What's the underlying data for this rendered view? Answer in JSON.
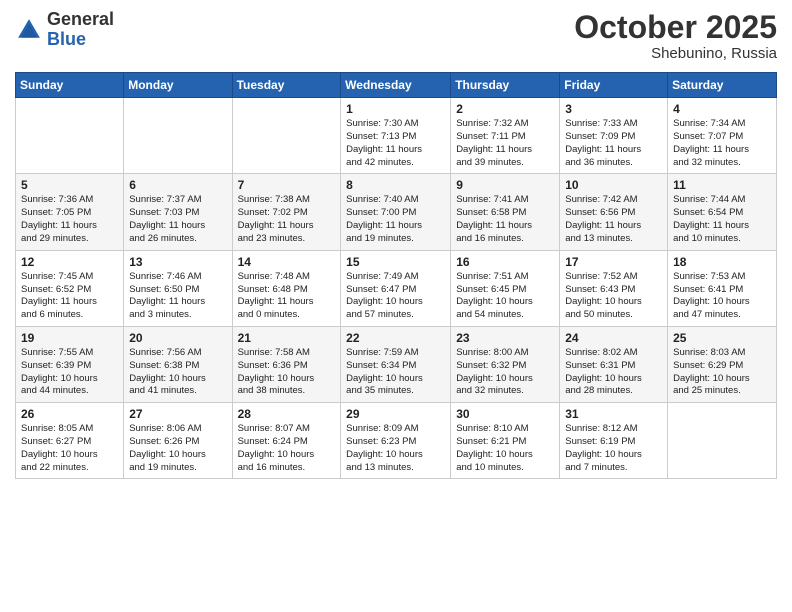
{
  "header": {
    "logo": {
      "general": "General",
      "blue": "Blue"
    },
    "month": "October 2025",
    "location": "Shebunino, Russia"
  },
  "weekdays": [
    "Sunday",
    "Monday",
    "Tuesday",
    "Wednesday",
    "Thursday",
    "Friday",
    "Saturday"
  ],
  "weeks": [
    [
      {
        "day": "",
        "info": ""
      },
      {
        "day": "",
        "info": ""
      },
      {
        "day": "",
        "info": ""
      },
      {
        "day": "1",
        "info": "Sunrise: 7:30 AM\nSunset: 7:13 PM\nDaylight: 11 hours\nand 42 minutes."
      },
      {
        "day": "2",
        "info": "Sunrise: 7:32 AM\nSunset: 7:11 PM\nDaylight: 11 hours\nand 39 minutes."
      },
      {
        "day": "3",
        "info": "Sunrise: 7:33 AM\nSunset: 7:09 PM\nDaylight: 11 hours\nand 36 minutes."
      },
      {
        "day": "4",
        "info": "Sunrise: 7:34 AM\nSunset: 7:07 PM\nDaylight: 11 hours\nand 32 minutes."
      }
    ],
    [
      {
        "day": "5",
        "info": "Sunrise: 7:36 AM\nSunset: 7:05 PM\nDaylight: 11 hours\nand 29 minutes."
      },
      {
        "day": "6",
        "info": "Sunrise: 7:37 AM\nSunset: 7:03 PM\nDaylight: 11 hours\nand 26 minutes."
      },
      {
        "day": "7",
        "info": "Sunrise: 7:38 AM\nSunset: 7:02 PM\nDaylight: 11 hours\nand 23 minutes."
      },
      {
        "day": "8",
        "info": "Sunrise: 7:40 AM\nSunset: 7:00 PM\nDaylight: 11 hours\nand 19 minutes."
      },
      {
        "day": "9",
        "info": "Sunrise: 7:41 AM\nSunset: 6:58 PM\nDaylight: 11 hours\nand 16 minutes."
      },
      {
        "day": "10",
        "info": "Sunrise: 7:42 AM\nSunset: 6:56 PM\nDaylight: 11 hours\nand 13 minutes."
      },
      {
        "day": "11",
        "info": "Sunrise: 7:44 AM\nSunset: 6:54 PM\nDaylight: 11 hours\nand 10 minutes."
      }
    ],
    [
      {
        "day": "12",
        "info": "Sunrise: 7:45 AM\nSunset: 6:52 PM\nDaylight: 11 hours\nand 6 minutes."
      },
      {
        "day": "13",
        "info": "Sunrise: 7:46 AM\nSunset: 6:50 PM\nDaylight: 11 hours\nand 3 minutes."
      },
      {
        "day": "14",
        "info": "Sunrise: 7:48 AM\nSunset: 6:48 PM\nDaylight: 11 hours\nand 0 minutes."
      },
      {
        "day": "15",
        "info": "Sunrise: 7:49 AM\nSunset: 6:47 PM\nDaylight: 10 hours\nand 57 minutes."
      },
      {
        "day": "16",
        "info": "Sunrise: 7:51 AM\nSunset: 6:45 PM\nDaylight: 10 hours\nand 54 minutes."
      },
      {
        "day": "17",
        "info": "Sunrise: 7:52 AM\nSunset: 6:43 PM\nDaylight: 10 hours\nand 50 minutes."
      },
      {
        "day": "18",
        "info": "Sunrise: 7:53 AM\nSunset: 6:41 PM\nDaylight: 10 hours\nand 47 minutes."
      }
    ],
    [
      {
        "day": "19",
        "info": "Sunrise: 7:55 AM\nSunset: 6:39 PM\nDaylight: 10 hours\nand 44 minutes."
      },
      {
        "day": "20",
        "info": "Sunrise: 7:56 AM\nSunset: 6:38 PM\nDaylight: 10 hours\nand 41 minutes."
      },
      {
        "day": "21",
        "info": "Sunrise: 7:58 AM\nSunset: 6:36 PM\nDaylight: 10 hours\nand 38 minutes."
      },
      {
        "day": "22",
        "info": "Sunrise: 7:59 AM\nSunset: 6:34 PM\nDaylight: 10 hours\nand 35 minutes."
      },
      {
        "day": "23",
        "info": "Sunrise: 8:00 AM\nSunset: 6:32 PM\nDaylight: 10 hours\nand 32 minutes."
      },
      {
        "day": "24",
        "info": "Sunrise: 8:02 AM\nSunset: 6:31 PM\nDaylight: 10 hours\nand 28 minutes."
      },
      {
        "day": "25",
        "info": "Sunrise: 8:03 AM\nSunset: 6:29 PM\nDaylight: 10 hours\nand 25 minutes."
      }
    ],
    [
      {
        "day": "26",
        "info": "Sunrise: 8:05 AM\nSunset: 6:27 PM\nDaylight: 10 hours\nand 22 minutes."
      },
      {
        "day": "27",
        "info": "Sunrise: 8:06 AM\nSunset: 6:26 PM\nDaylight: 10 hours\nand 19 minutes."
      },
      {
        "day": "28",
        "info": "Sunrise: 8:07 AM\nSunset: 6:24 PM\nDaylight: 10 hours\nand 16 minutes."
      },
      {
        "day": "29",
        "info": "Sunrise: 8:09 AM\nSunset: 6:23 PM\nDaylight: 10 hours\nand 13 minutes."
      },
      {
        "day": "30",
        "info": "Sunrise: 8:10 AM\nSunset: 6:21 PM\nDaylight: 10 hours\nand 10 minutes."
      },
      {
        "day": "31",
        "info": "Sunrise: 8:12 AM\nSunset: 6:19 PM\nDaylight: 10 hours\nand 7 minutes."
      },
      {
        "day": "",
        "info": ""
      }
    ]
  ]
}
